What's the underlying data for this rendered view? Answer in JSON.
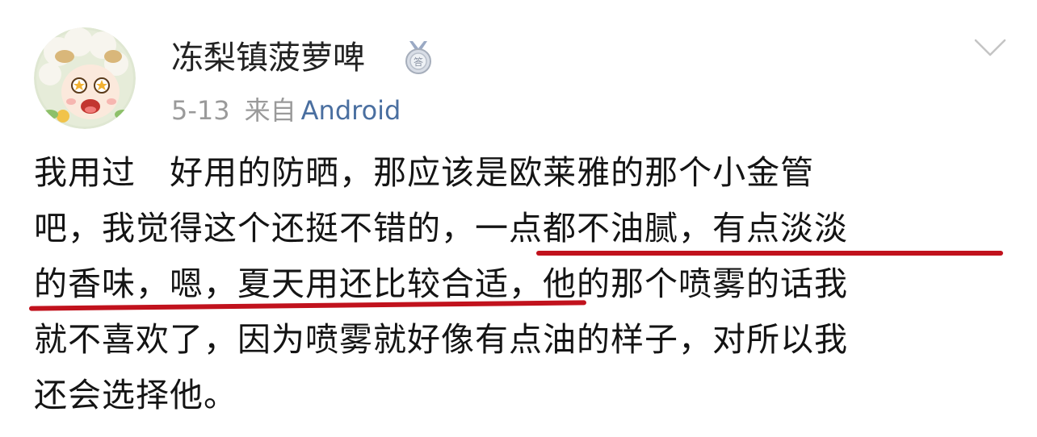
{
  "post": {
    "username": "冻梨镇菠萝啤",
    "badge_icon": "medal-badge-icon",
    "date": "5-13",
    "source_prefix": "来自",
    "source": "Android",
    "menu_icon": "chevron-down-icon",
    "body_lines": [
      "我用过   好用的防晒，那应该是欧莱雅的那个小金管",
      "吧，我觉得这个还挺不错的，一点都不油腻，有点淡淡",
      "的香味，嗯，夏天用还比较合适，他的那个喷雾的话我",
      "就不喜欢了，因为喷雾就好像有点油的样子，对所以我",
      "还会选择他。"
    ],
    "highlight_color": "#c1121d",
    "accent_color": "#4a6fa0"
  }
}
